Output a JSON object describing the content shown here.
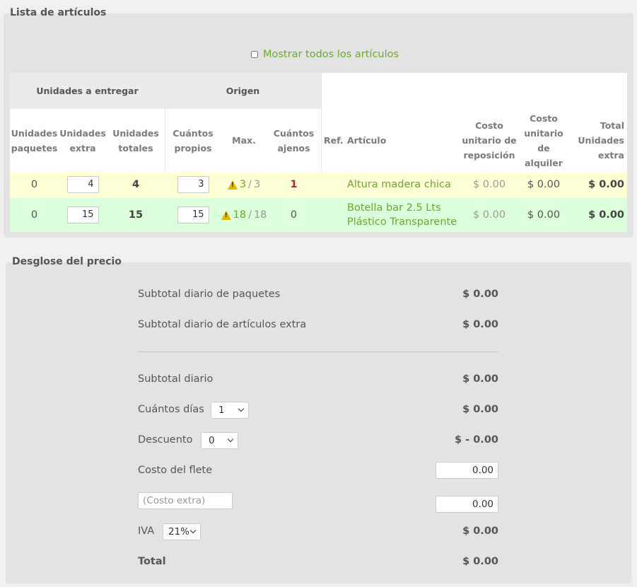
{
  "articles_section": {
    "title": "Lista de artículos",
    "show_all_label": "Mostrar todos los artículos",
    "show_all_checked": false,
    "group_headers": {
      "units": "Unidades a entregar",
      "origin": "Origen"
    },
    "columns": {
      "package_units": "Unidades paquetes",
      "extra_units": "Unidades extra",
      "total_units": "Unidades totales",
      "own_qty": "Cuántos propios",
      "max": "Max.",
      "third_party_qty": "Cuántos ajenos",
      "ref": "Ref.",
      "article": "Artículo",
      "replacement_cost": "Costo unitario de reposición",
      "rental_cost": "Costo unitario de alquiler",
      "total_extra": "Total Unidades extra"
    },
    "rows": [
      {
        "package_units": "0",
        "extra_units": "4",
        "total_units": "4",
        "own_qty": "3",
        "max_available": "3",
        "max_separator": "/",
        "max_total": "3",
        "third_party_qty": "1",
        "ref": "",
        "article": "Altura madera chica",
        "replacement_cost": "$ 0.00",
        "rental_cost": "$ 0.00",
        "total_extra": "$ 0.00",
        "row_color": "#ffffd6"
      },
      {
        "package_units": "0",
        "extra_units": "15",
        "total_units": "15",
        "own_qty": "15",
        "max_available": "18",
        "max_separator": "/",
        "max_total": "18",
        "third_party_qty": "0",
        "ref": "",
        "article_line1": "Botella bar 2.5 Lts",
        "article_line2": "Plástico Transparente",
        "replacement_cost": "$ 0.00",
        "rental_cost": "$ 0.00",
        "total_extra": "$ 0.00",
        "row_color": "#dcffdc"
      }
    ]
  },
  "breakdown": {
    "title": "Desglose del precio",
    "packages_subtotal_label": "Subtotal diario de paquetes",
    "packages_subtotal_value": "$ 0.00",
    "extras_subtotal_label": "Subtotal diario de artículos extra",
    "extras_subtotal_value": "$ 0.00",
    "daily_subtotal_label": "Subtotal diario",
    "daily_subtotal_value": "$ 0.00",
    "days_label": "Cuántos días",
    "days_selected": "1",
    "days_value": "$ 0.00",
    "discount_label": "Descuento",
    "discount_selected": "0",
    "discount_value": "$ - 0.00",
    "freight_label": "Costo del flete",
    "freight_value": "0.00",
    "extra_cost_placeholder": "(Costo extra)",
    "extra_cost_value": "0.00",
    "iva_label": "IVA",
    "iva_selected": "21%",
    "iva_value": "$ 0.00",
    "total_label": "Total",
    "total_value": "$ 0.00"
  },
  "colors": {
    "accent_green": "#6ba82f",
    "warning_yellow": "#e0b800",
    "alert_red": "#b3262a"
  },
  "icons": {
    "warning": "warning-triangle-icon",
    "select_arrow": "chevron-down-icon"
  }
}
